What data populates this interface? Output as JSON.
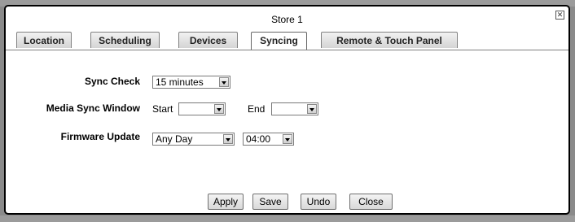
{
  "dialog": {
    "title": "Store 1",
    "close_glyph": "✕"
  },
  "tabs": [
    {
      "label": "Location",
      "active": false
    },
    {
      "label": "Scheduling",
      "active": false
    },
    {
      "label": "Devices",
      "active": false
    },
    {
      "label": "Syncing",
      "active": true
    },
    {
      "label": "Remote & Touch Panel",
      "active": false
    }
  ],
  "form": {
    "sync_check": {
      "label": "Sync Check",
      "value": "15 minutes"
    },
    "media_sync_window": {
      "label": "Media Sync Window",
      "start_label": "Start",
      "start_value": "",
      "end_label": "End",
      "end_value": ""
    },
    "firmware_update": {
      "label": "Firmware Update",
      "day_value": "Any Day",
      "time_value": "04:00"
    }
  },
  "buttons": {
    "apply": "Apply",
    "save": "Save",
    "undo": "Undo",
    "close": "Close"
  }
}
